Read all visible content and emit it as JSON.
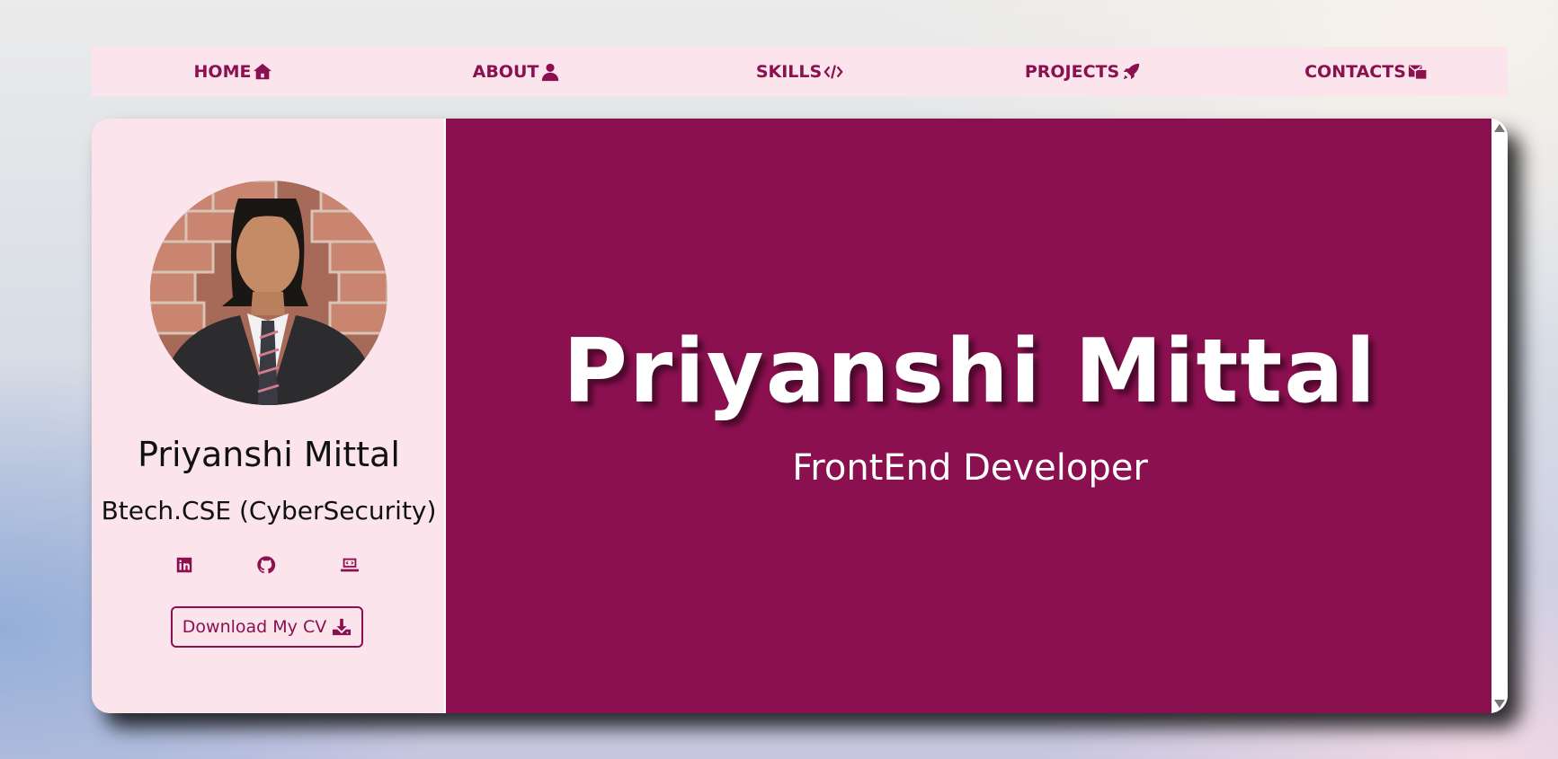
{
  "nav": {
    "items": [
      {
        "label": "HOME",
        "icon": "house-icon"
      },
      {
        "label": "ABOUT",
        "icon": "user-icon"
      },
      {
        "label": "SKILLS",
        "icon": "code-icon"
      },
      {
        "label": "PROJECTS",
        "icon": "rocket-icon"
      },
      {
        "label": "CONTACTS",
        "icon": "envelope-icon"
      }
    ]
  },
  "profile": {
    "name": "Priyanshi Mittal",
    "degree": "Btech.CSE (CyberSecurity)",
    "socials": [
      "linkedin-icon",
      "github-icon",
      "laptop-code-icon"
    ],
    "cv_button": "Download My CV"
  },
  "hero": {
    "name": "Priyanshi Mittal",
    "role": "FrontEnd Developer"
  },
  "colors": {
    "accent": "#8b1050",
    "panel": "#fbe4ec"
  }
}
